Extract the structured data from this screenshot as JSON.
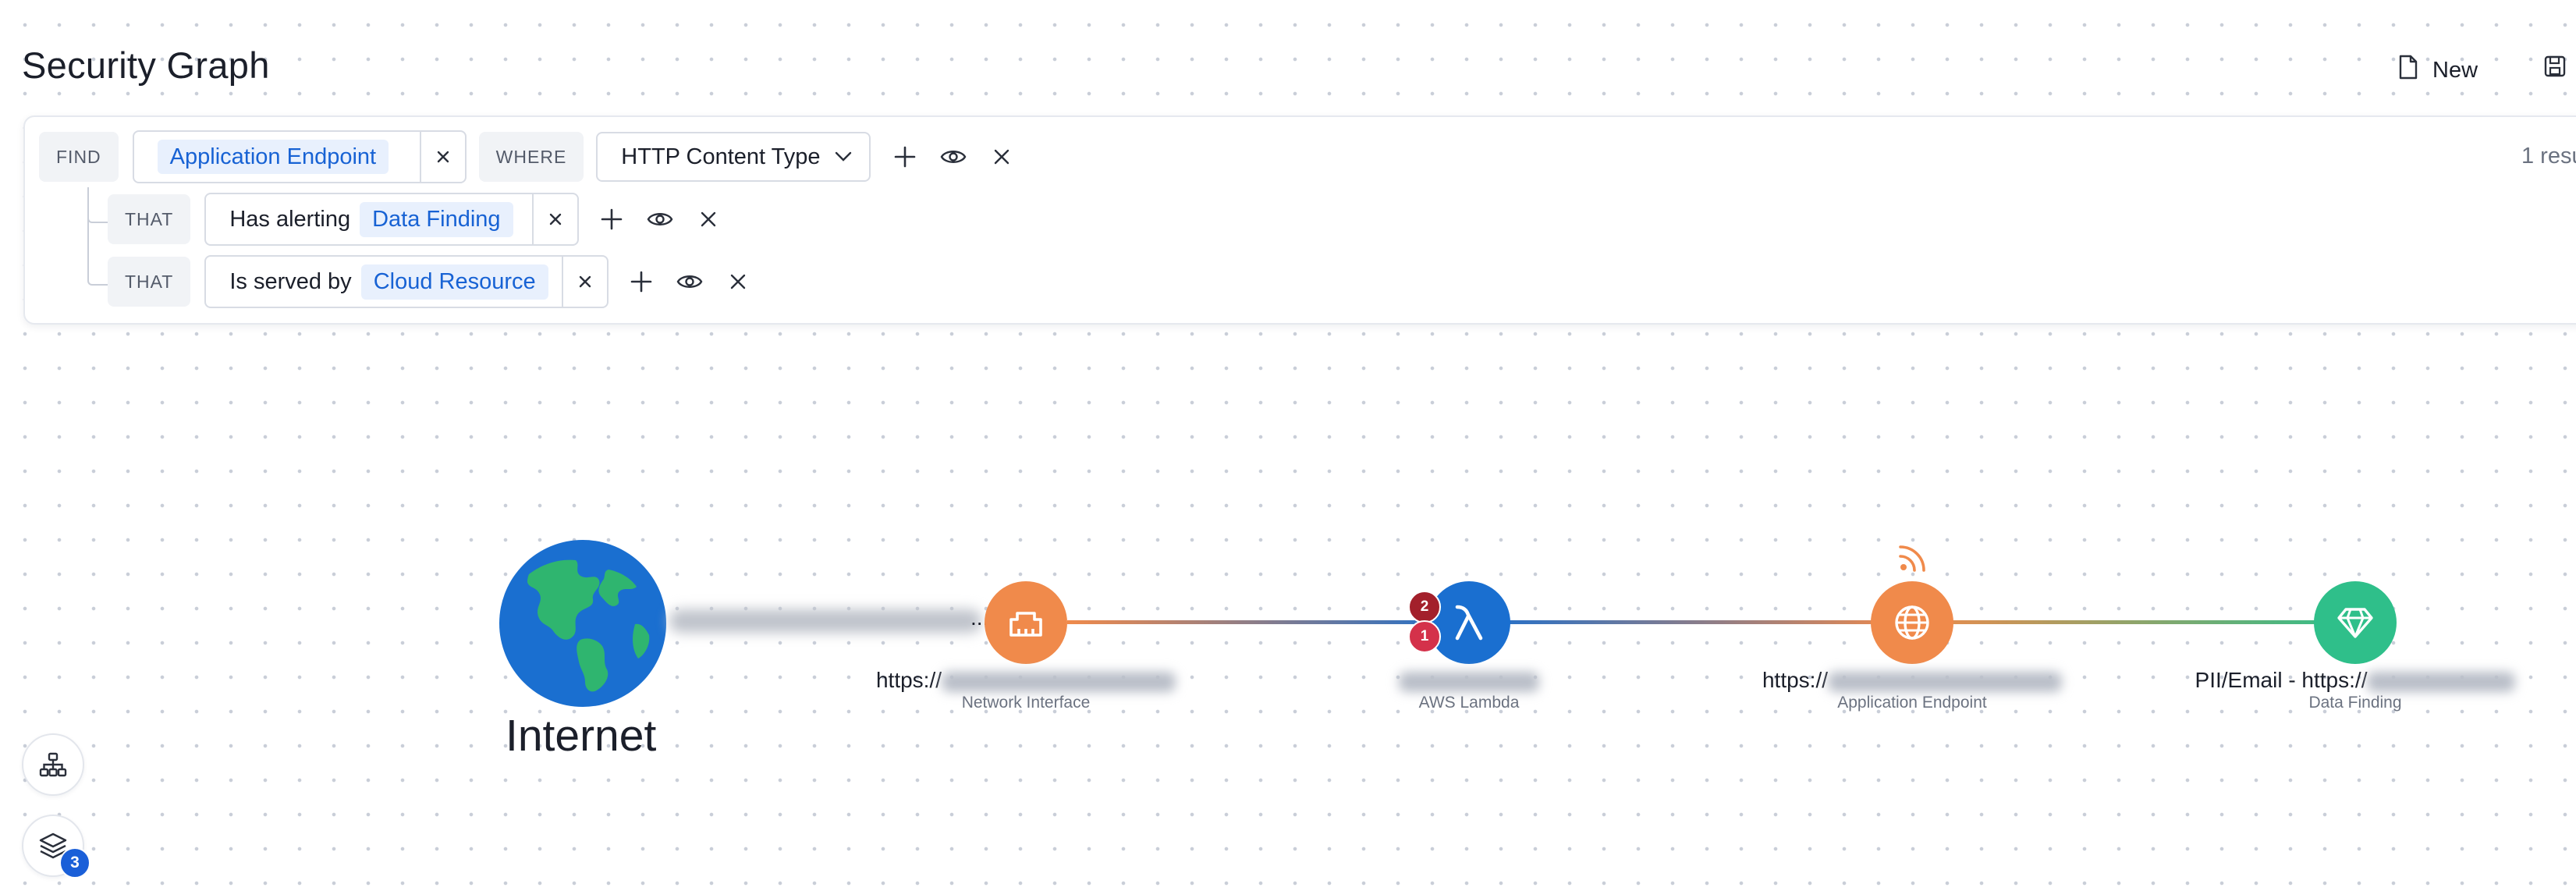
{
  "page_title": "Security Graph",
  "toolbar": {
    "new_label": "New"
  },
  "query": {
    "find_keyword": "FIND",
    "find_entity": "Application Endpoint",
    "where_keyword": "WHERE",
    "where_field": "HTTP Content Type",
    "conditions": [
      {
        "keyword": "THAT",
        "relation": "Has alerting",
        "entity": "Data Finding"
      },
      {
        "keyword": "THAT",
        "relation": "Is served by",
        "entity": "Cloud Resource"
      }
    ],
    "result_count": "1 resu"
  },
  "graph": {
    "internet_label": "Internet",
    "nodes": [
      {
        "label_prefix": "https://",
        "type": "Network Interface",
        "color": "#f08a4b",
        "icon": "ethernet-port-icon"
      },
      {
        "label_prefix": "",
        "type": "AWS Lambda",
        "color": "#1a6fd0",
        "icon": "lambda-icon"
      },
      {
        "label_prefix": "https://",
        "type": "Application Endpoint",
        "color": "#f08a4b",
        "icon": "globe-icon"
      },
      {
        "label_prefix": "PII/Email - https://",
        "type": "Data Finding",
        "color": "#2fbf8a",
        "icon": "diamond-icon"
      }
    ],
    "lambda_badges": [
      {
        "count": "2",
        "color": "#a3202b"
      },
      {
        "count": "1",
        "color": "#d4314a"
      }
    ],
    "edge_colors": {
      "orange": "#f08a4b",
      "blue": "#1a6fd0",
      "green": "#2fbf8a"
    }
  },
  "controls": {
    "layers_count": "3"
  }
}
